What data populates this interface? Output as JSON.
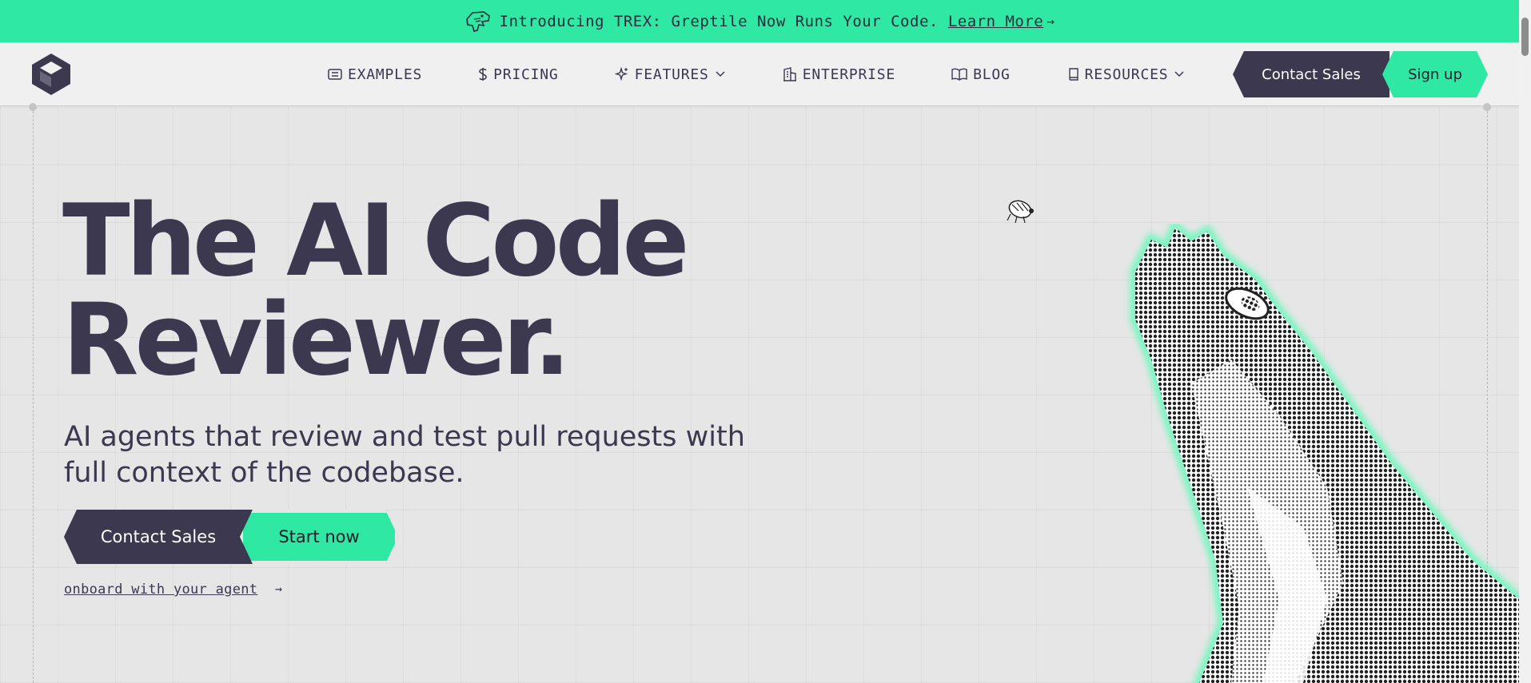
{
  "banner": {
    "text": "Introducing TREX: Greptile Now Runs Your Code.",
    "link": "Learn More",
    "arrow": "→"
  },
  "nav": {
    "items": [
      {
        "label": "EXAMPLES",
        "icon": "examples-icon"
      },
      {
        "label": "PRICING",
        "icon": "dollar-icon"
      },
      {
        "label": "FEATURES",
        "icon": "sparkle-icon",
        "dropdown": true
      },
      {
        "label": "ENTERPRISE",
        "icon": "building-icon"
      },
      {
        "label": "BLOG",
        "icon": "book-open-icon"
      },
      {
        "label": "RESOURCES",
        "icon": "book-icon",
        "dropdown": true
      }
    ],
    "contact_sales": "Contact Sales",
    "sign_up": "Sign up"
  },
  "hero": {
    "title_line1": "The AI Code",
    "title_line2": "Reviewer.",
    "subtitle_line1": "AI agents that review and test pull requests with",
    "subtitle_line2": "full context of the codebase.",
    "contact_sales": "Contact Sales",
    "start_now": "Start now",
    "agent_link": "onboard with your agent",
    "agent_arrow": "→"
  },
  "colors": {
    "accent": "#2ee8a3",
    "dark": "#3b3850",
    "background": "#e6e6e6"
  }
}
